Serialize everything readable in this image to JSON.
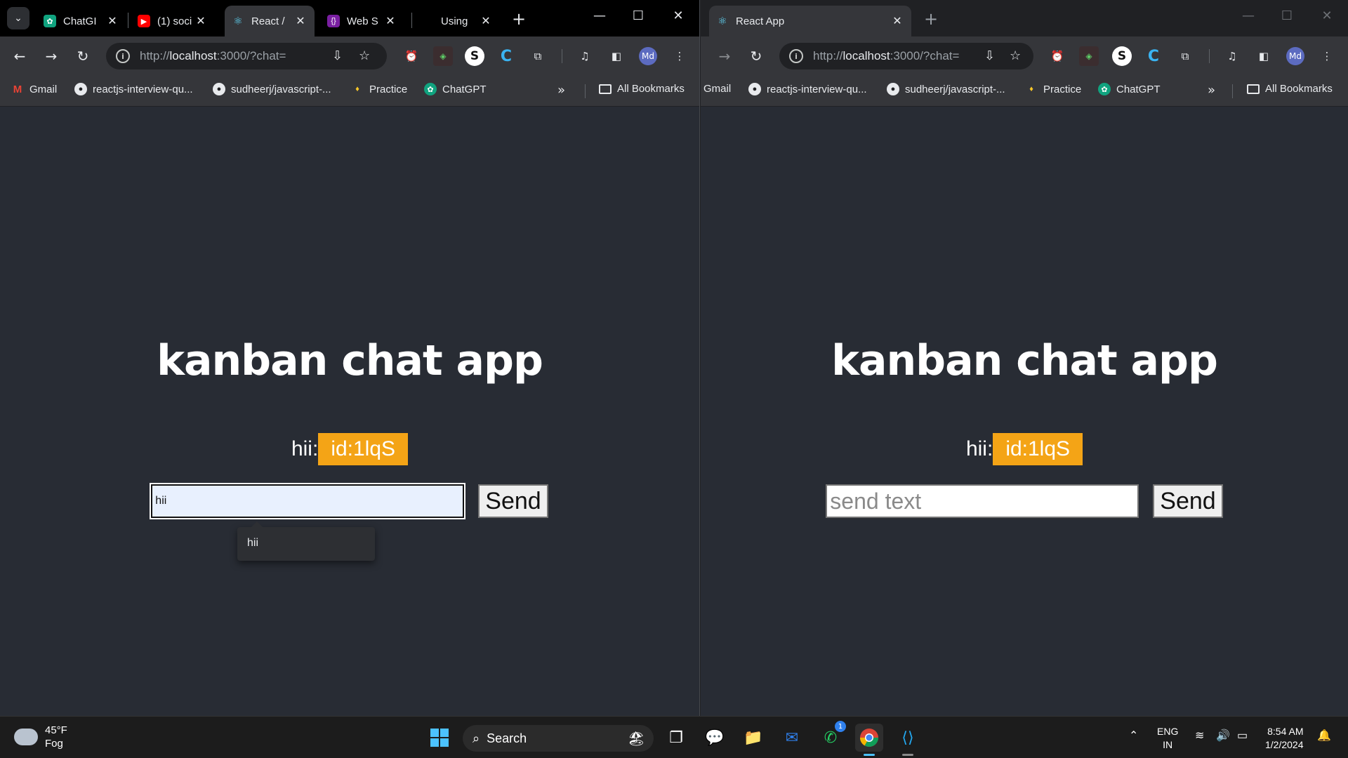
{
  "left_browser": {
    "tabs": [
      {
        "title": "ChatGI",
        "favicon": "chatgpt-icon"
      },
      {
        "title": "(1) soci",
        "favicon": "youtube-icon"
      },
      {
        "title": "React /",
        "favicon": "react-icon"
      },
      {
        "title": "Web S",
        "favicon": "websocket-icon"
      },
      {
        "title": "Using",
        "favicon": "blank-icon"
      }
    ],
    "url_prefix": "http://",
    "url_host": "localhost",
    "url_rest": ":3000/?chat=",
    "bookmarks": [
      "Gmail",
      "reactjs-interview-qu...",
      "sudheerj/javascript-...",
      "Practice",
      "ChatGPT"
    ],
    "all_bookmarks": "All Bookmarks",
    "page": {
      "title": "kanban chat app",
      "message_text": "hii:",
      "message_id": "id:1lqS",
      "input_value": "hii",
      "send_label": "Send",
      "autocomplete_suggestion": "hii"
    }
  },
  "right_browser": {
    "tabs": [
      {
        "title": "React App",
        "favicon": "react-icon"
      }
    ],
    "url_prefix": "http://",
    "url_host": "localhost",
    "url_rest": ":3000/?chat=",
    "bookmarks": [
      "Gmail",
      "reactjs-interview-qu...",
      "sudheerj/javascript-...",
      "Practice",
      "ChatGPT"
    ],
    "all_bookmarks": "All Bookmarks",
    "page": {
      "title": "kanban chat app",
      "message_text": "hii:",
      "message_id": "id:1lqS",
      "input_placeholder": "send text",
      "send_label": "Send"
    }
  },
  "taskbar": {
    "weather_temp": "45°F",
    "weather_desc": "Fog",
    "search_label": "Search",
    "whatsapp_badge": "1",
    "language_top": "ENG",
    "language_bottom": "IN",
    "time": "8:54 AM",
    "date": "1/2/2024"
  },
  "colors": {
    "page_bg": "#282c34",
    "id_badge": "#f4a416",
    "tab_active": "#35363a"
  }
}
